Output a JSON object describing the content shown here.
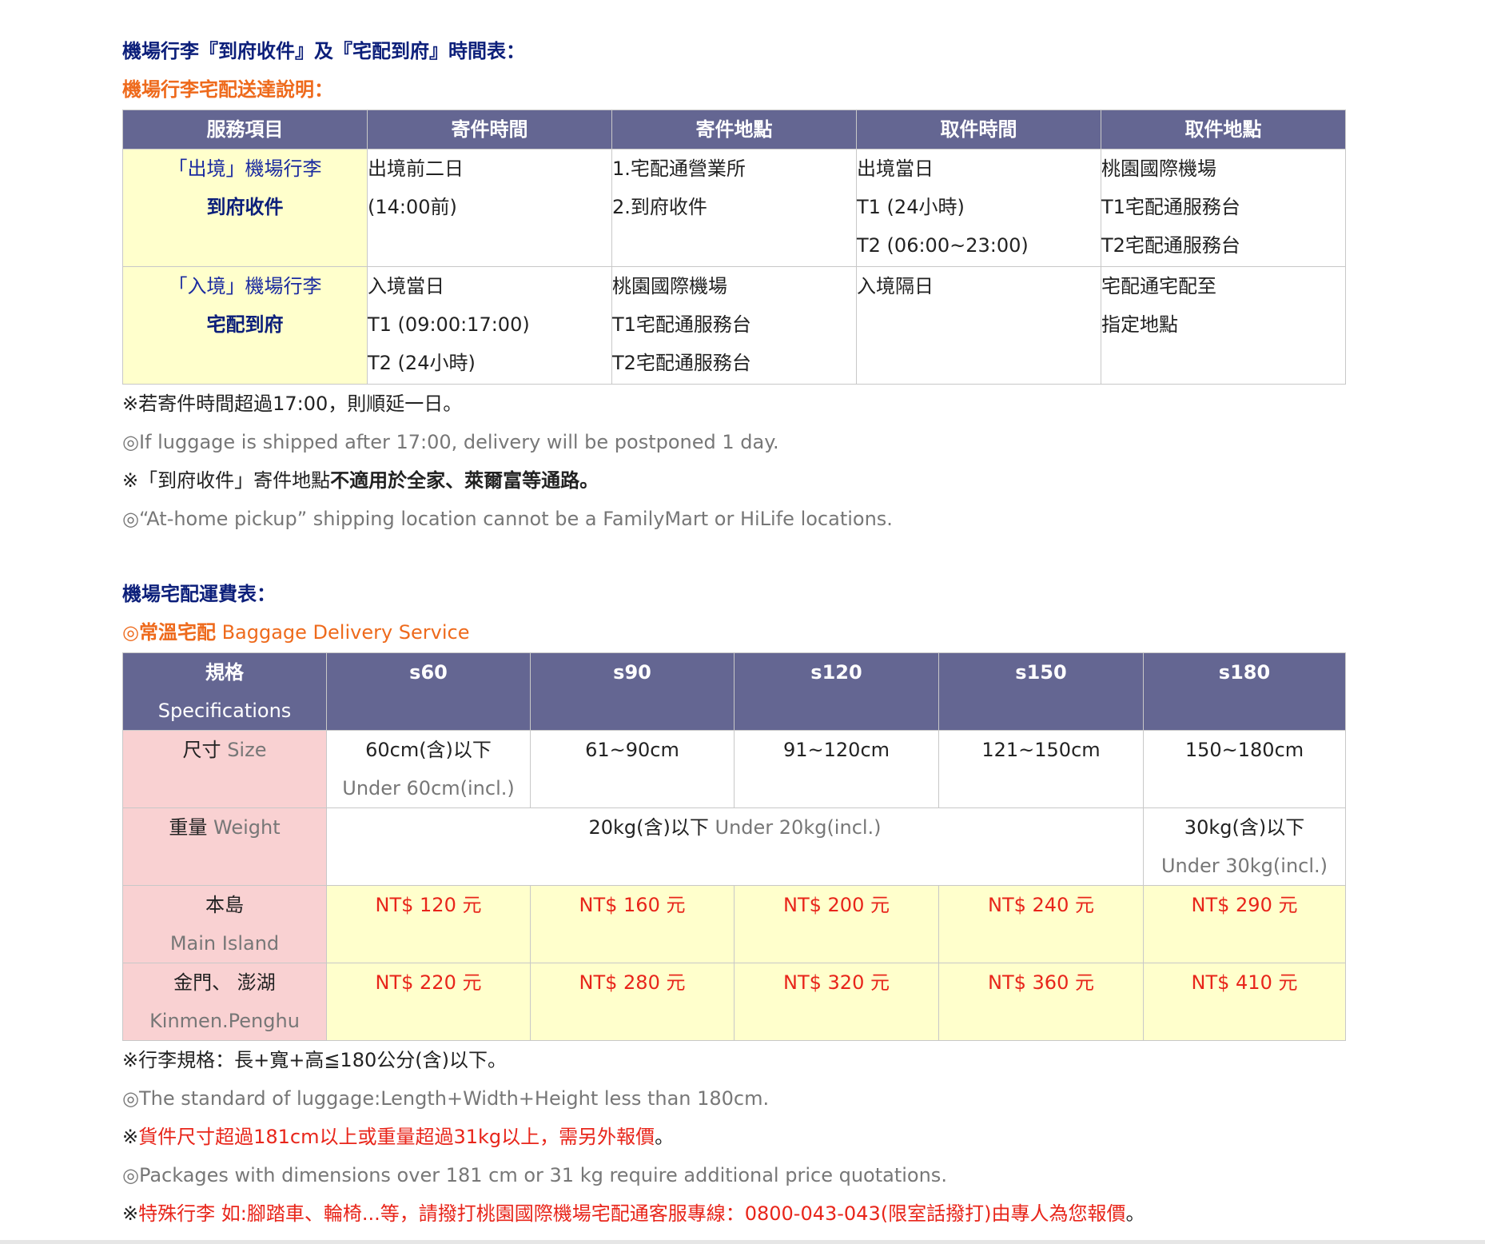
{
  "section1": {
    "title": "機場行李『到府收件』及『宅配到府』時間表：",
    "subtitle": "機場行李宅配送達說明：",
    "headers": [
      "服務項目",
      "寄件時間",
      "寄件地點",
      "取件時間",
      "取件地點"
    ],
    "rows": [
      {
        "service_label": "「出境」機場行李",
        "service_sub": "到府收件",
        "send_time": [
          "出境前二日",
          "(14:00前)"
        ],
        "send_place": [
          "1.宅配通營業所",
          "2.到府收件"
        ],
        "pick_time": [
          "出境當日",
          "T1 (24小時)",
          "T2 (06:00~23:00)"
        ],
        "pick_place": [
          "桃園國際機場",
          "T1宅配通服務台",
          "T2宅配通服務台"
        ]
      },
      {
        "service_label": "「入境」機場行李",
        "service_sub": "宅配到府",
        "send_time": [
          "入境當日",
          "T1 (09:00:17:00)",
          "T2 (24小時)"
        ],
        "send_place": [
          "桃園國際機場",
          "T1宅配通服務台",
          "T2宅配通服務台"
        ],
        "pick_time": [
          "入境隔日"
        ],
        "pick_place": [
          "宅配通宅配至",
          "指定地點"
        ]
      }
    ],
    "notes": {
      "n1": "※若寄件時間超過17:00，則順延一日。",
      "n1_en": "◎If luggage is shipped after 17:00, delivery will be postponed 1 day.",
      "n2_prefix": "※「到府收件」寄件地點",
      "n2_bold": "不適用於全家、萊爾富等通路。",
      "n2_en": "◎“At-home pickup” shipping location cannot be a FamilyMart or HiLife locations."
    }
  },
  "section2": {
    "title": "機場宅配運費表：",
    "subtitle_bold": "◎常溫宅配",
    "subtitle_rest": " Baggage Delivery Service",
    "spec_header": "規格",
    "spec_header_en": "Specifications",
    "sizes": [
      "s60",
      "s90",
      "s120",
      "s150",
      "s180"
    ],
    "size_label": "尺寸",
    "size_label_en": "Size",
    "size_values": [
      "60cm(含)以下",
      "61~90cm",
      "91~120cm",
      "121~150cm",
      "150~180cm"
    ],
    "size_value0_en": "Under 60cm(incl.)",
    "weight_label": "重量",
    "weight_label_en": "Weight",
    "weight_main": "20kg(含)以下",
    "weight_main_en": "Under 20kg(incl.)",
    "weight_last": "30kg(含)以下",
    "weight_last_en": "Under 30kg(incl.)",
    "main_island_label": "本島",
    "main_island_label_en": "Main Island",
    "main_island_prices": [
      "NT$ 120 元",
      "NT$ 160 元",
      "NT$ 200 元",
      "NT$ 240 元",
      "NT$ 290 元"
    ],
    "outer_label": "金門、 澎湖",
    "outer_label_en": "Kinmen.Penghu",
    "outer_prices": [
      "NT$ 220 元",
      "NT$ 280 元",
      "NT$ 320 元",
      "NT$ 360 元",
      "NT$ 410 元"
    ],
    "notes": {
      "n1": "※行李規格：長+寬+高≦180公分(含)以下。",
      "n1_en": "◎The standard of luggage:Length+Width+Height less than 180cm.",
      "n2_mark": "※",
      "n2_red": "貨件尺寸超過181cm以上或重量超過31kg以上，需另外報價",
      "n2_end": "。",
      "n2_en": "◎Packages with dimensions over 181 cm or 31 kg require additional price quotations.",
      "n3_mark": "※",
      "n3_red": "特殊行李 如:腳踏車、輪椅...等，請撥打桃園國際機場宅配通客服專線：0800-043-043(限室話撥打)由專人為您報價",
      "n3_end": "。"
    }
  },
  "colors": {
    "header_bg": "#646692",
    "service_bg": "#ffffcc",
    "label_bg": "#f9d1d2",
    "navy": "#0c1f7a",
    "orange": "#ee6a1c",
    "red": "#e8251a"
  }
}
